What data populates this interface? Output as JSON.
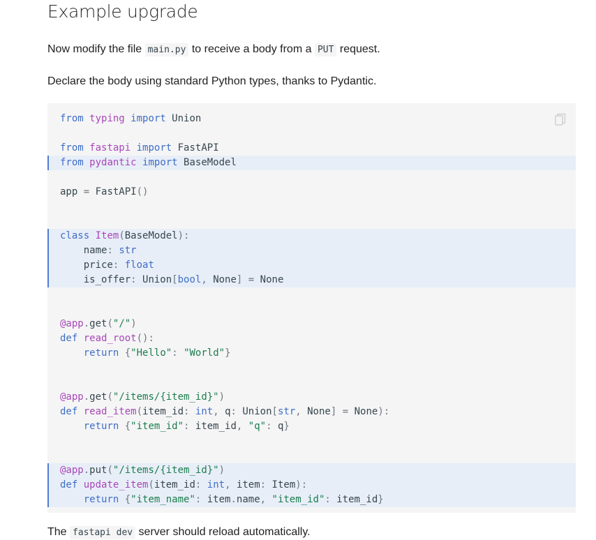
{
  "heading": "Example upgrade",
  "para1": {
    "before": "Now modify the file ",
    "file": "main.py",
    "middle": " to receive a body from a ",
    "method": "PUT",
    "after": " request."
  },
  "para2": "Declare the body using standard Python types, thanks to Pydantic.",
  "para3": {
    "before": "The ",
    "code": "fastapi dev",
    "after": " server should reload automatically."
  },
  "copy_icon": "copy-icon",
  "code_lines": [
    {
      "hl": false,
      "tokens": [
        [
          "kw",
          "from"
        ],
        [
          "",
          " "
        ],
        [
          "mod",
          "typing"
        ],
        [
          "",
          ""
        ],
        [
          "",
          " "
        ],
        [
          "kw",
          "import"
        ],
        [
          "",
          " Union"
        ]
      ]
    },
    {
      "hl": false,
      "tokens": []
    },
    {
      "hl": false,
      "tokens": [
        [
          "kw",
          "from"
        ],
        [
          "",
          " "
        ],
        [
          "mod",
          "fastapi"
        ],
        [
          "",
          " "
        ],
        [
          "kw",
          "import"
        ],
        [
          "",
          " FastAPI"
        ]
      ]
    },
    {
      "hl": true,
      "tokens": [
        [
          "kw",
          "from"
        ],
        [
          "",
          " "
        ],
        [
          "mod",
          "pydantic"
        ],
        [
          "",
          " "
        ],
        [
          "kw",
          "import"
        ],
        [
          "",
          " BaseModel"
        ]
      ]
    },
    {
      "hl": false,
      "tokens": []
    },
    {
      "hl": false,
      "tokens": [
        [
          "",
          "app "
        ],
        [
          "op",
          "="
        ],
        [
          "",
          " FastAPI"
        ],
        [
          "op",
          "()"
        ]
      ]
    },
    {
      "hl": false,
      "tokens": []
    },
    {
      "hl": false,
      "tokens": []
    },
    {
      "hl": true,
      "tokens": [
        [
          "kw",
          "class"
        ],
        [
          "",
          " "
        ],
        [
          "cls",
          "Item"
        ],
        [
          "op",
          "("
        ],
        [
          "",
          "BaseModel"
        ],
        [
          "op",
          "):"
        ]
      ]
    },
    {
      "hl": true,
      "tokens": [
        [
          "",
          "    name"
        ],
        [
          "op",
          ":"
        ],
        [
          "",
          " "
        ],
        [
          "bi",
          "str"
        ]
      ]
    },
    {
      "hl": true,
      "tokens": [
        [
          "",
          "    price"
        ],
        [
          "op",
          ":"
        ],
        [
          "",
          " "
        ],
        [
          "bi",
          "float"
        ]
      ]
    },
    {
      "hl": true,
      "tokens": [
        [
          "",
          "    is_offer"
        ],
        [
          "op",
          ":"
        ],
        [
          "",
          " Union"
        ],
        [
          "op",
          "["
        ],
        [
          "bi",
          "bool"
        ],
        [
          "op",
          ","
        ],
        [
          "",
          " None"
        ],
        [
          "op",
          "]"
        ],
        [
          "",
          " "
        ],
        [
          "op",
          "="
        ],
        [
          "",
          " None"
        ]
      ]
    },
    {
      "hl": false,
      "tokens": []
    },
    {
      "hl": false,
      "tokens": []
    },
    {
      "hl": false,
      "tokens": [
        [
          "dec",
          "@app"
        ],
        [
          "op",
          "."
        ],
        [
          "",
          "get"
        ],
        [
          "op",
          "("
        ],
        [
          "str",
          "\"/\""
        ],
        [
          "op",
          ")"
        ]
      ]
    },
    {
      "hl": false,
      "tokens": [
        [
          "kw",
          "def"
        ],
        [
          "",
          " "
        ],
        [
          "fn",
          "read_root"
        ],
        [
          "op",
          "():"
        ]
      ]
    },
    {
      "hl": false,
      "tokens": [
        [
          "",
          "    "
        ],
        [
          "kw",
          "return"
        ],
        [
          "",
          " "
        ],
        [
          "op",
          "{"
        ],
        [
          "str",
          "\"Hello\""
        ],
        [
          "op",
          ":"
        ],
        [
          "",
          " "
        ],
        [
          "str",
          "\"World\""
        ],
        [
          "op",
          "}"
        ]
      ]
    },
    {
      "hl": false,
      "tokens": []
    },
    {
      "hl": false,
      "tokens": []
    },
    {
      "hl": false,
      "tokens": [
        [
          "dec",
          "@app"
        ],
        [
          "op",
          "."
        ],
        [
          "",
          "get"
        ],
        [
          "op",
          "("
        ],
        [
          "str",
          "\"/items/{item_id}\""
        ],
        [
          "op",
          ")"
        ]
      ]
    },
    {
      "hl": false,
      "tokens": [
        [
          "kw",
          "def"
        ],
        [
          "",
          " "
        ],
        [
          "fn",
          "read_item"
        ],
        [
          "op",
          "("
        ],
        [
          "",
          "item_id"
        ],
        [
          "op",
          ":"
        ],
        [
          "",
          " "
        ],
        [
          "bi",
          "int"
        ],
        [
          "op",
          ","
        ],
        [
          "",
          " q"
        ],
        [
          "op",
          ":"
        ],
        [
          "",
          " Union"
        ],
        [
          "op",
          "["
        ],
        [
          "bi",
          "str"
        ],
        [
          "op",
          ","
        ],
        [
          "",
          " None"
        ],
        [
          "op",
          "]"
        ],
        [
          "",
          " "
        ],
        [
          "op",
          "="
        ],
        [
          "",
          " None"
        ],
        [
          "op",
          "):"
        ]
      ]
    },
    {
      "hl": false,
      "tokens": [
        [
          "",
          "    "
        ],
        [
          "kw",
          "return"
        ],
        [
          "",
          " "
        ],
        [
          "op",
          "{"
        ],
        [
          "str",
          "\"item_id\""
        ],
        [
          "op",
          ":"
        ],
        [
          "",
          " item_id"
        ],
        [
          "op",
          ","
        ],
        [
          "",
          " "
        ],
        [
          "str",
          "\"q\""
        ],
        [
          "op",
          ":"
        ],
        [
          "",
          " q"
        ],
        [
          "op",
          "}"
        ]
      ]
    },
    {
      "hl": false,
      "tokens": []
    },
    {
      "hl": false,
      "tokens": []
    },
    {
      "hl": true,
      "tokens": [
        [
          "dec",
          "@app"
        ],
        [
          "op",
          "."
        ],
        [
          "",
          "put"
        ],
        [
          "op",
          "("
        ],
        [
          "str",
          "\"/items/{item_id}\""
        ],
        [
          "op",
          ")"
        ]
      ]
    },
    {
      "hl": true,
      "tokens": [
        [
          "kw",
          "def"
        ],
        [
          "",
          " "
        ],
        [
          "fn",
          "update_item"
        ],
        [
          "op",
          "("
        ],
        [
          "",
          "item_id"
        ],
        [
          "op",
          ":"
        ],
        [
          "",
          " "
        ],
        [
          "bi",
          "int"
        ],
        [
          "op",
          ","
        ],
        [
          "",
          " item"
        ],
        [
          "op",
          ":"
        ],
        [
          "",
          " Item"
        ],
        [
          "op",
          "):"
        ]
      ]
    },
    {
      "hl": true,
      "tokens": [
        [
          "",
          "    "
        ],
        [
          "kw",
          "return"
        ],
        [
          "",
          " "
        ],
        [
          "op",
          "{"
        ],
        [
          "str",
          "\"item_name\""
        ],
        [
          "op",
          ":"
        ],
        [
          "",
          " item"
        ],
        [
          "op",
          "."
        ],
        [
          "",
          "name"
        ],
        [
          "op",
          ","
        ],
        [
          "",
          " "
        ],
        [
          "str",
          "\"item_id\""
        ],
        [
          "op",
          ":"
        ],
        [
          "",
          " item_id"
        ],
        [
          "op",
          "}"
        ]
      ]
    }
  ]
}
